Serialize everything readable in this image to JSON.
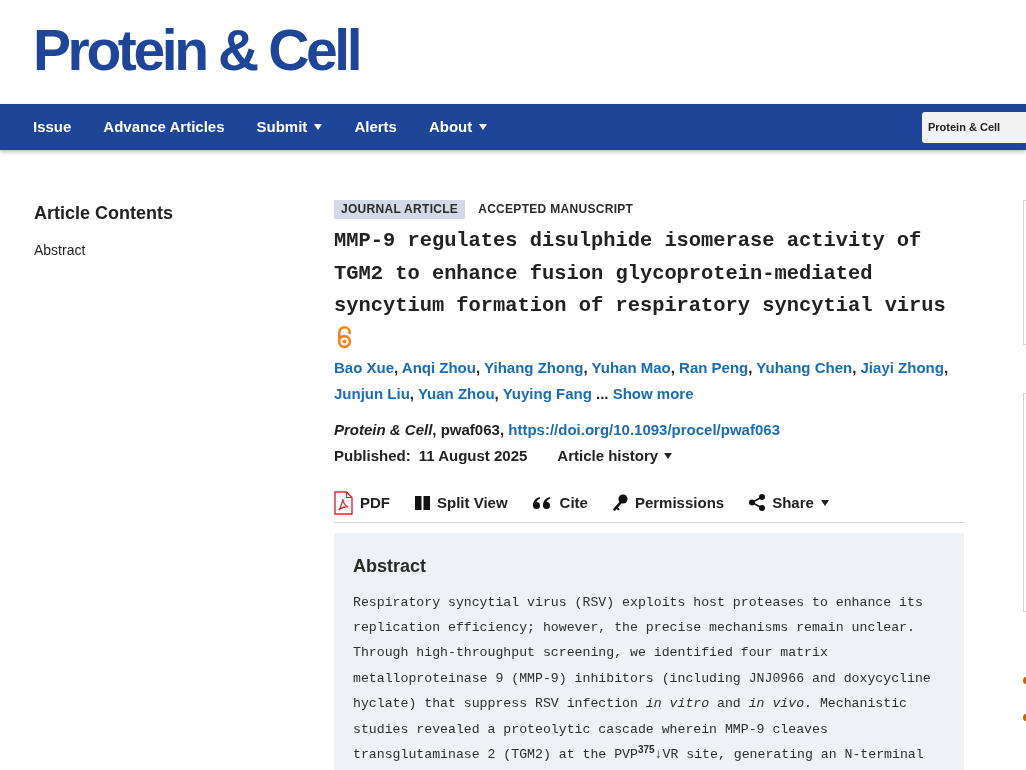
{
  "header": {
    "logo": "Protein & Cell"
  },
  "nav": {
    "items": [
      {
        "label": "Issue",
        "dropdown": false
      },
      {
        "label": "Advance Articles",
        "dropdown": false
      },
      {
        "label": "Submit",
        "dropdown": true
      },
      {
        "label": "Alerts",
        "dropdown": false
      },
      {
        "label": "About",
        "dropdown": true
      }
    ],
    "journal_select": "Protein & Cell"
  },
  "sidebar": {
    "title": "Article Contents",
    "items": [
      {
        "label": "Abstract"
      }
    ]
  },
  "article": {
    "tags": [
      {
        "label": "JOURNAL ARTICLE",
        "kind": "type"
      },
      {
        "label": "ACCEPTED MANUSCRIPT",
        "kind": "status"
      }
    ],
    "title": "MMP-9 regulates disulphide isomerase activity of TGM2 to enhance fusion glycoprotein-mediated syncytium formation of respiratory syncytial virus",
    "open_access": true,
    "authors": [
      {
        "name": "Bao Xue",
        "sep": ","
      },
      {
        "name": "Anqi Zhou",
        "sep": ","
      },
      {
        "name": "Yihang Zhong",
        "sep": ","
      },
      {
        "name": "Yuhan Mao",
        "sep": ","
      },
      {
        "name": "Ran Peng",
        "sep": ","
      },
      {
        "name": "Yuhang Chen",
        "sep": ","
      },
      {
        "name": "Jiayi Zhong",
        "sep": ","
      },
      {
        "name": "Junjun Liu",
        "sep": ","
      },
      {
        "name": "Yuan Zhou",
        "sep": ","
      },
      {
        "name": "Yuying Fang",
        "sep": " ..."
      }
    ],
    "show_more": "Show more",
    "citation": "*Protein & Cell*, pwaf063,",
    "doi": "https://doi.org/10.1093/procel/pwaf063",
    "published_label": "Published:",
    "published_date": "11 August 2025",
    "history": "Article history"
  },
  "tools": [
    {
      "label": "PDF",
      "kind": "pdf",
      "dropdown": false
    },
    {
      "label": "Split View",
      "kind": "split",
      "dropdown": false
    },
    {
      "label": "Cite",
      "kind": "cite",
      "dropdown": false
    },
    {
      "label": "Permissions",
      "kind": "permissions",
      "dropdown": false
    },
    {
      "label": "Share",
      "kind": "share",
      "dropdown": true
    }
  ],
  "abstract": {
    "heading": "Abstract",
    "text": "Respiratory syncytial virus (RSV) exploits host proteases to enhance its replication efficiency; however, the precise mechanisms remain unclear. Through high-throughput screening, we identified four matrix metalloproteinase 9 (MMP-9) inhibitors (including JNJ0966 and doxycycline hyclate) that suppress RSV infection *in vitro* and *in vivo*. Mechanistic studies revealed a proteolytic cascade wherein MMP-9 cleaves transglutaminase 2 (TGM2) at the PVP$^{375}$↓VR site, generating an N-terminal"
  }
}
